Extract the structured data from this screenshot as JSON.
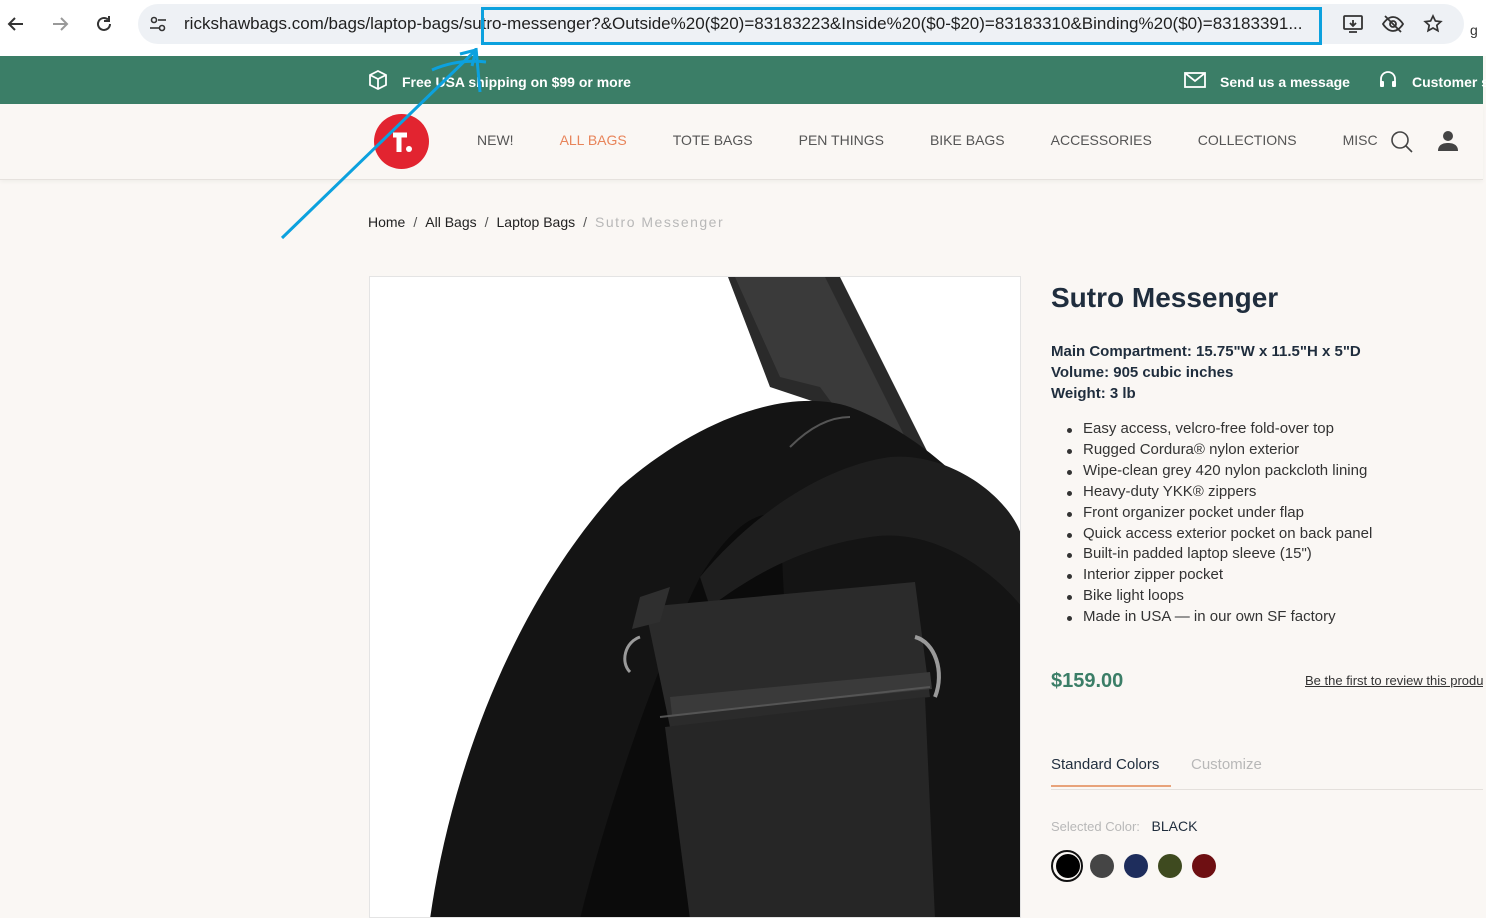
{
  "browser": {
    "url": "rickshawbags.com/bags/laptop-bags/sutro-messenger?&Outside%20($20)=83183223&Inside%20($0-$20)=83183310&Binding%20($0)=83183391...",
    "side_text": "g"
  },
  "promo": {
    "shipping": "Free USA shipping on $99 or more",
    "message": "Send us a message",
    "service": "Customer ser"
  },
  "nav": {
    "items": [
      "NEW!",
      "ALL BAGS",
      "TOTE BAGS",
      "PEN THINGS",
      "BIKE BAGS",
      "ACCESSORIES",
      "COLLECTIONS",
      "MISC"
    ],
    "active_index": 1,
    "active_color": "#e8845a"
  },
  "breadcrumb": {
    "home": "Home",
    "all_bags": "All Bags",
    "laptop_bags": "Laptop Bags",
    "current": "Sutro Messenger",
    "sep": "/"
  },
  "product": {
    "title": "Sutro Messenger",
    "specs": [
      "Main Compartment: 15.75\"W x 11.5\"H x 5\"D",
      "Volume: 905 cubic inches",
      "Weight: 3 lb"
    ],
    "features": [
      "Easy access, velcro-free fold-over top",
      "Rugged Cordura® nylon exterior",
      "Wipe-clean grey 420 nylon packcloth lining",
      "Heavy-duty YKK® zippers",
      "Front organizer pocket under flap",
      "Quick access exterior pocket on back panel",
      "Built-in padded laptop sleeve (15\")",
      "Interior zipper pocket",
      "Bike light loops",
      "Made in USA — in our own SF factory"
    ],
    "price": "$159.00",
    "review_link": "Be the first to review this product",
    "tabs": {
      "standard": "Standard Colors",
      "customize": "Customize"
    },
    "selected_color_label": "Selected Color:",
    "selected_color": "BLACK",
    "swatches": [
      "#000000",
      "#454545",
      "#1e2d5c",
      "#3e4a1f",
      "#6e0f12"
    ]
  },
  "colors": {
    "promo_bg": "#3b7e67",
    "logo": "#e22430",
    "annotation": "#0ca1de"
  }
}
